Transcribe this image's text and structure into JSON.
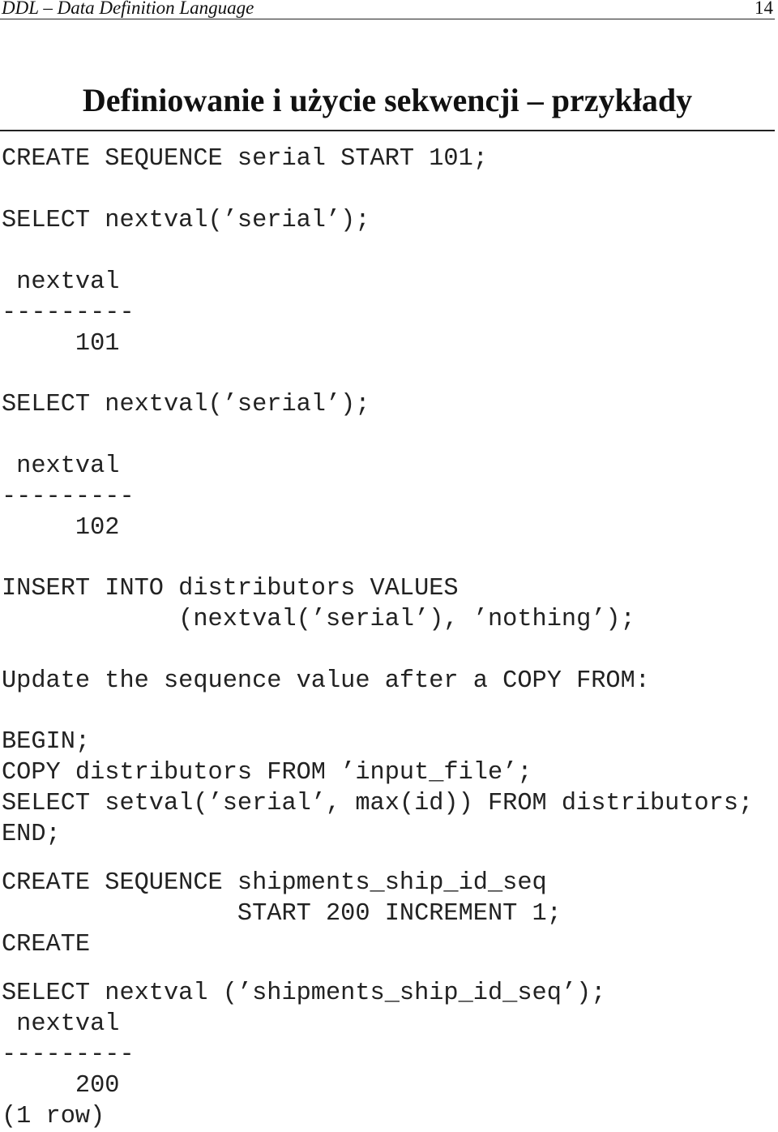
{
  "header": {
    "running_title": "DDL – Data Definition Language",
    "page_number": "14"
  },
  "title": "Definiowanie i użycie sekwencji – przykłady",
  "blocks": [
    {
      "id": "create-seq",
      "text": "CREATE SEQUENCE serial START 101;"
    },
    {
      "id": "select-1",
      "text": "SELECT nextval(’serial’);"
    },
    {
      "id": "result-1",
      "text": " nextval\n---------\n     101"
    },
    {
      "id": "select-2",
      "text": "SELECT nextval(’serial’);"
    },
    {
      "id": "result-2",
      "text": " nextval\n---------\n     102"
    },
    {
      "id": "insert",
      "text": "INSERT INTO distributors VALUES\n            (nextval(’serial’), ’nothing’);"
    },
    {
      "id": "comment",
      "text": "Update the sequence value after a COPY FROM:"
    },
    {
      "id": "transaction",
      "text": "BEGIN;\nCOPY distributors FROM ’input_file’;\nSELECT setval(’serial’, max(id)) FROM distributors;\nEND;"
    },
    {
      "id": "create-seq-2",
      "text": "CREATE SEQUENCE shipments_ship_id_seq\n                START 200 INCREMENT 1;\nCREATE"
    },
    {
      "id": "select-3",
      "text": "SELECT nextval (’shipments_ship_id_seq’);\n nextval\n---------\n     200\n(1 row)"
    }
  ]
}
